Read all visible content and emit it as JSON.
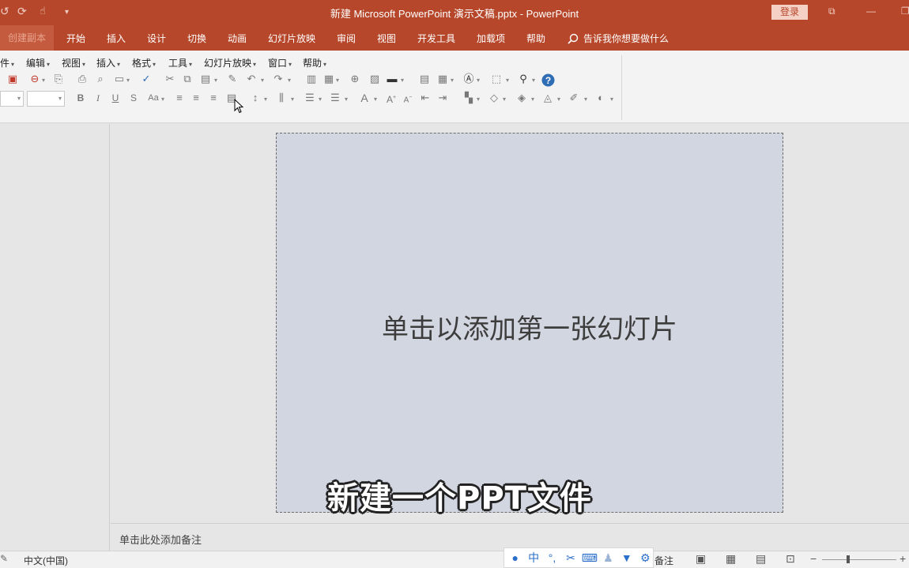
{
  "titlebar": {
    "title": "新建 Microsoft PowerPoint 演示文稿.pptx  -  PowerPoint",
    "login": "登录",
    "quick_access": [
      "↺",
      "⟳",
      "▾"
    ]
  },
  "tabs": {
    "file": "创建副本",
    "items": [
      "开始",
      "插入",
      "设计",
      "切换",
      "动画",
      "幻灯片放映",
      "审阅",
      "视图",
      "开发工具",
      "加载项",
      "帮助"
    ],
    "tellme": "告诉我你想要做什么"
  },
  "classic_menu": [
    "件",
    "编辑",
    "视图",
    "插入",
    "格式",
    "工具",
    "幻灯片放映",
    "窗口",
    "帮助"
  ],
  "slide": {
    "placeholder": "单击以添加第一张幻灯片"
  },
  "caption": "新建一个PPT文件",
  "notes": {
    "placeholder": "单击此处添加备注"
  },
  "statusbar": {
    "language": "中文(中国)",
    "notes_label": "备注",
    "zoom_fraction": 0.35
  },
  "ime": {
    "mode": "中",
    "icons": [
      "user-icon",
      "chinese-mode-icon",
      "punctuation-icon",
      "scissors-icon",
      "keyboard-icon",
      "person-icon",
      "shirt-icon",
      "gear-icon"
    ]
  },
  "colors": {
    "accent": "#b7472a",
    "slide_bg": "#d2d6e0",
    "ribbon_bg": "#f3f3f3"
  }
}
